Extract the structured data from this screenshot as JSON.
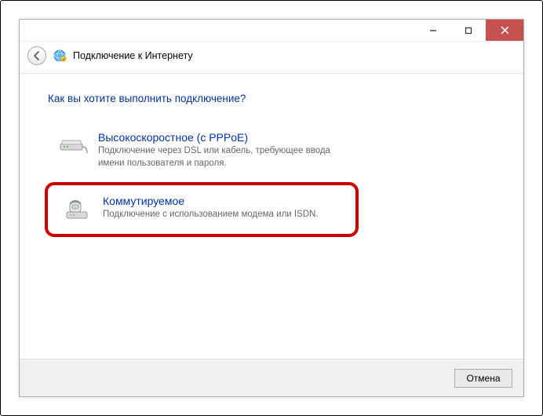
{
  "window": {
    "title": "Подключение к Интернету"
  },
  "page": {
    "question": "Как вы хотите выполнить подключение?"
  },
  "options": [
    {
      "icon": "modem-cable-icon",
      "title": "Высокоскоростное (с PPPoE)",
      "desc": "Подключение через DSL или кабель, требующее ввода имени пользователя и пароля."
    },
    {
      "icon": "dialup-phone-icon",
      "title": "Коммутируемое",
      "desc": "Подключение с использованием модема или ISDN."
    }
  ],
  "buttons": {
    "cancel": "Отмена"
  }
}
